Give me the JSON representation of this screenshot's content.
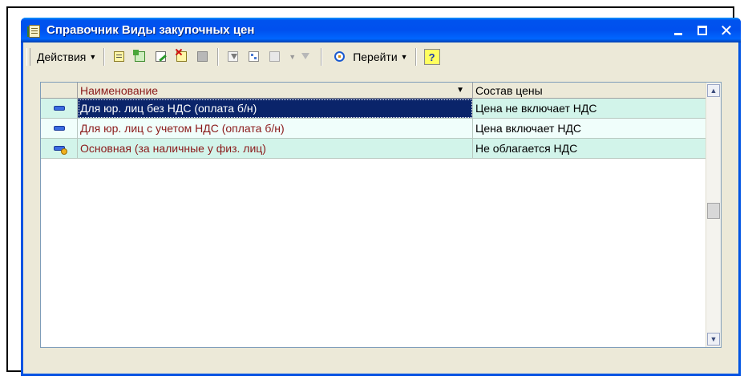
{
  "window": {
    "title": "Справочник Виды закупочных цен"
  },
  "toolbar": {
    "actions_label": "Действия",
    "goto_label": "Перейти",
    "help_label": "?"
  },
  "grid": {
    "columns": [
      "Наименование",
      "Состав цены"
    ],
    "rows": [
      {
        "name": "Для юр. лиц без НДС (оплата б/н)",
        "composition": "Цена не включает НДС",
        "selected": true
      },
      {
        "name": "Для юр. лиц с учетом НДС (оплата б/н)",
        "composition": "Цена включает НДС",
        "selected": false
      },
      {
        "name": "Основная (за наличные у физ. лиц)",
        "composition": "Не облагается НДС",
        "selected": false
      }
    ]
  }
}
